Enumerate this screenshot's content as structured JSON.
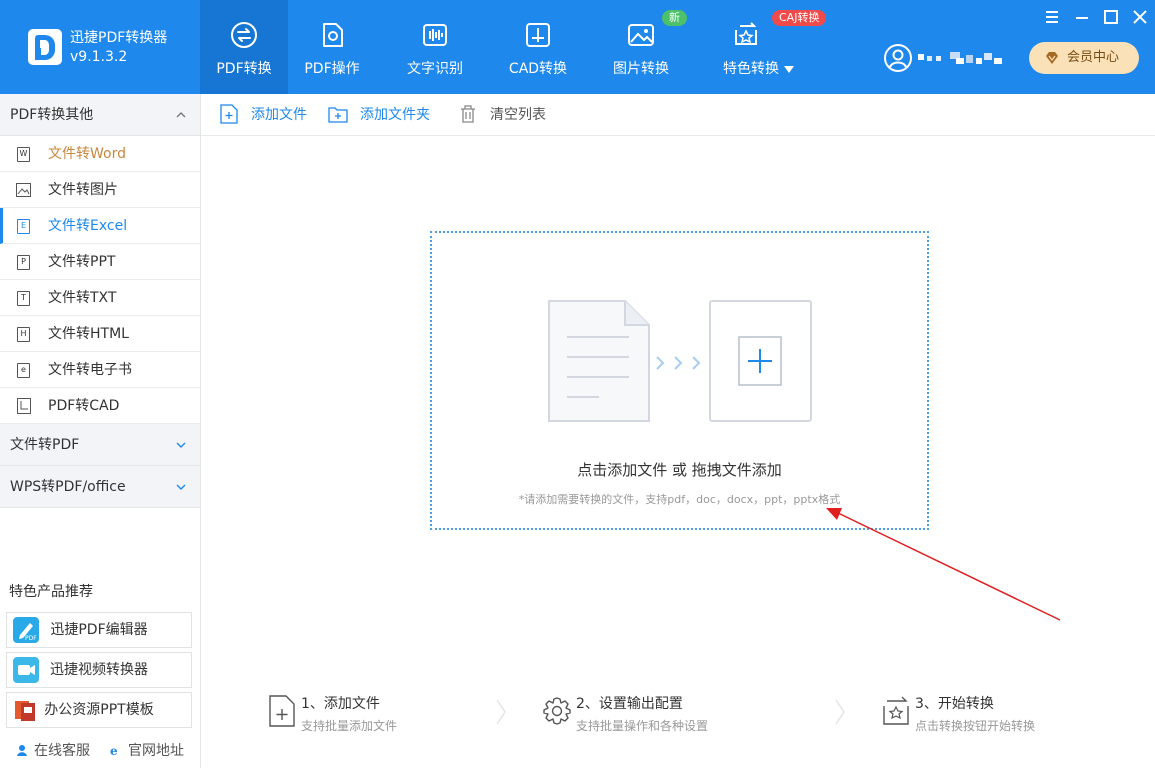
{
  "app": {
    "name": "迅捷PDF转换器",
    "version": "v9.1.3.2"
  },
  "nav": {
    "tabs": [
      {
        "label": "PDF转换",
        "icon": "convert-icon"
      },
      {
        "label": "PDF操作",
        "icon": "gear-icon"
      },
      {
        "label": "文字识别",
        "icon": "ocr-icon"
      },
      {
        "label": "CAD转换",
        "icon": "cad-icon"
      },
      {
        "label": "图片转换",
        "icon": "image-icon",
        "badge": "新"
      },
      {
        "label": "特色转换",
        "icon": "star-icon",
        "badge": "CAJ转换"
      }
    ],
    "active": "PDF转换"
  },
  "header": {
    "vip_label": "会员中心"
  },
  "sidebar": {
    "section1": {
      "title": "PDF转换其他",
      "items": [
        {
          "label": "文件转Word",
          "icon": "word-doc-icon",
          "glyph": "W"
        },
        {
          "label": "文件转图片",
          "icon": "image-doc-icon",
          "glyph": ""
        },
        {
          "label": "文件转Excel",
          "icon": "excel-doc-icon",
          "glyph": "E"
        },
        {
          "label": "文件转PPT",
          "icon": "ppt-doc-icon",
          "glyph": "P"
        },
        {
          "label": "文件转TXT",
          "icon": "txt-doc-icon",
          "glyph": "T"
        },
        {
          "label": "文件转HTML",
          "icon": "html-doc-icon",
          "glyph": "H"
        },
        {
          "label": "文件转电子书",
          "icon": "ebook-doc-icon",
          "glyph": "e"
        },
        {
          "label": "PDF转CAD",
          "icon": "cad-doc-icon",
          "glyph": ""
        }
      ]
    },
    "section2": {
      "title": "文件转PDF"
    },
    "section3": {
      "title": "WPS转PDF/office"
    },
    "recommend": {
      "title": "特色产品推荐",
      "items": [
        {
          "label": "迅捷PDF编辑器",
          "icon": "pdf-editor-app-icon",
          "color": "#2aa9e8"
        },
        {
          "label": "迅捷视频转换器",
          "icon": "video-converter-app-icon",
          "color": "#3bb7e8"
        },
        {
          "label": "办公资源PPT模板",
          "icon": "ppt-template-app-icon",
          "color": "#e45a2e"
        }
      ]
    },
    "links": {
      "service": "在线客服",
      "website": "官网地址"
    }
  },
  "toolbar": {
    "add_file": "添加文件",
    "add_folder": "添加文件夹",
    "clear": "清空列表"
  },
  "dropzone": {
    "title": "点击添加文件 或 拖拽文件添加",
    "hint": "*请添加需要转换的文件，支持pdf，doc，docx，ppt，pptx格式"
  },
  "steps": [
    {
      "title": "1、添加文件",
      "sub": "支持批量添加文件"
    },
    {
      "title": "2、设置输出配置",
      "sub": "支持批量操作和各种设置"
    },
    {
      "title": "3、开始转换",
      "sub": "点击转换按钮开始转换"
    }
  ],
  "colors": {
    "primary": "#1e88ec",
    "accent_orange": "#c8873e",
    "badge_green": "#4cc06a",
    "badge_red": "#f14a4a",
    "annotation_arrow": "#e02020"
  }
}
